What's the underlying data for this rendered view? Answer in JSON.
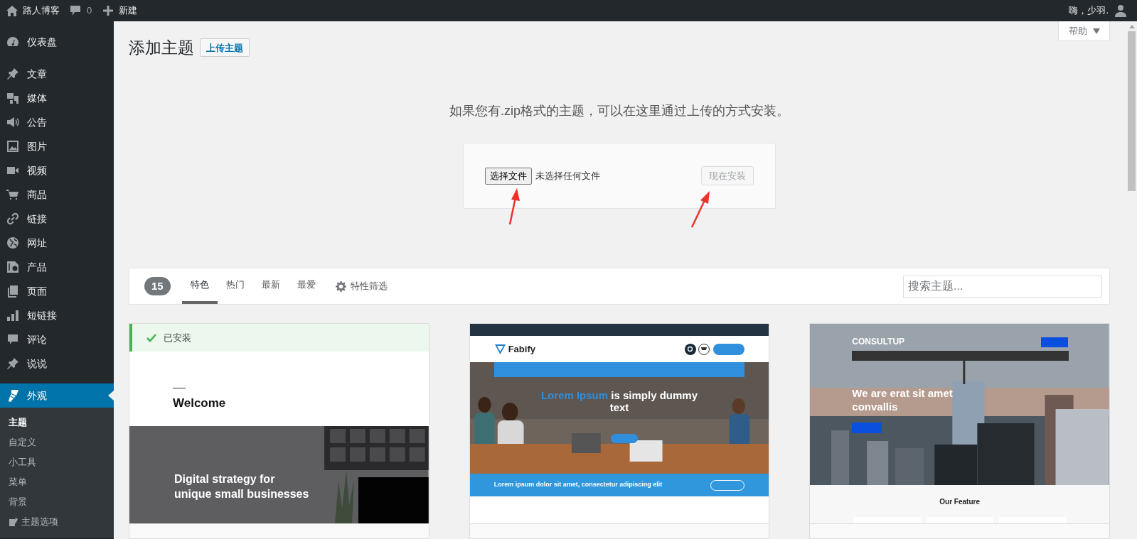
{
  "admin_bar": {
    "site_name": "路人博客",
    "comments_count": "0",
    "new_label": "新建",
    "greeting": "嗨，少羽."
  },
  "sidebar": {
    "items": [
      {
        "label": "仪表盘",
        "selected": false
      },
      {
        "label": "文章",
        "selected": false
      },
      {
        "label": "媒体",
        "selected": false
      },
      {
        "label": "公告",
        "selected": false
      },
      {
        "label": "图片",
        "selected": false
      },
      {
        "label": "视频",
        "selected": false
      },
      {
        "label": "商品",
        "selected": false
      },
      {
        "label": "链接",
        "selected": false
      },
      {
        "label": "网址",
        "selected": false
      },
      {
        "label": "产品",
        "selected": false
      },
      {
        "label": "页面",
        "selected": false
      },
      {
        "label": "短链接",
        "selected": false
      },
      {
        "label": "评论",
        "selected": false
      },
      {
        "label": "说说",
        "selected": false
      },
      {
        "label": "外观",
        "selected": true,
        "children": [
          {
            "label": "主题",
            "selected": true
          },
          {
            "label": "自定义",
            "selected": false
          },
          {
            "label": "小工具",
            "selected": false
          },
          {
            "label": "菜单",
            "selected": false
          },
          {
            "label": "背景",
            "selected": false
          },
          {
            "label": "主题选项",
            "selected": false
          }
        ]
      }
    ]
  },
  "help_tab": {
    "label": "帮助"
  },
  "header": {
    "title": "添加主题",
    "upload_button": "上传主题"
  },
  "upload": {
    "message": "如果您有.zip格式的主题，可以在这里通过上传的方式安装。",
    "choose_button": "选择文件",
    "file_status": "未选择任何文件",
    "install_button": "现在安装",
    "install_disabled": true
  },
  "filter_bar": {
    "count": "15",
    "tabs": [
      {
        "label": "特色",
        "selected": true
      },
      {
        "label": "热门",
        "selected": false
      },
      {
        "label": "最新",
        "selected": false
      },
      {
        "label": "最爱",
        "selected": false
      }
    ],
    "feature_filter": "特性筛选",
    "search": {
      "placeholder": "搜索主题..."
    }
  },
  "themes": [
    {
      "kind": "minimal",
      "installed": true,
      "installed_label": "已安装",
      "preview": {
        "heading": "Welcome",
        "tagline_lines": [
          "Digital strategy for",
          "unique small businesses"
        ]
      }
    },
    {
      "kind": "business",
      "installed": false,
      "preview": {
        "logo": "Fabify",
        "headline_highlight": "Lorem Ipsum",
        "headline": "is simply dummy text",
        "banner": "Lorem ipsum dolor sit amet, consectetur adipiscing elit"
      }
    },
    {
      "kind": "corporate",
      "installed": false,
      "preview": {
        "logo": "CONSULTUP",
        "headline": "We are erat sit amet convallis",
        "section_title": "Our Feature"
      }
    }
  ]
}
